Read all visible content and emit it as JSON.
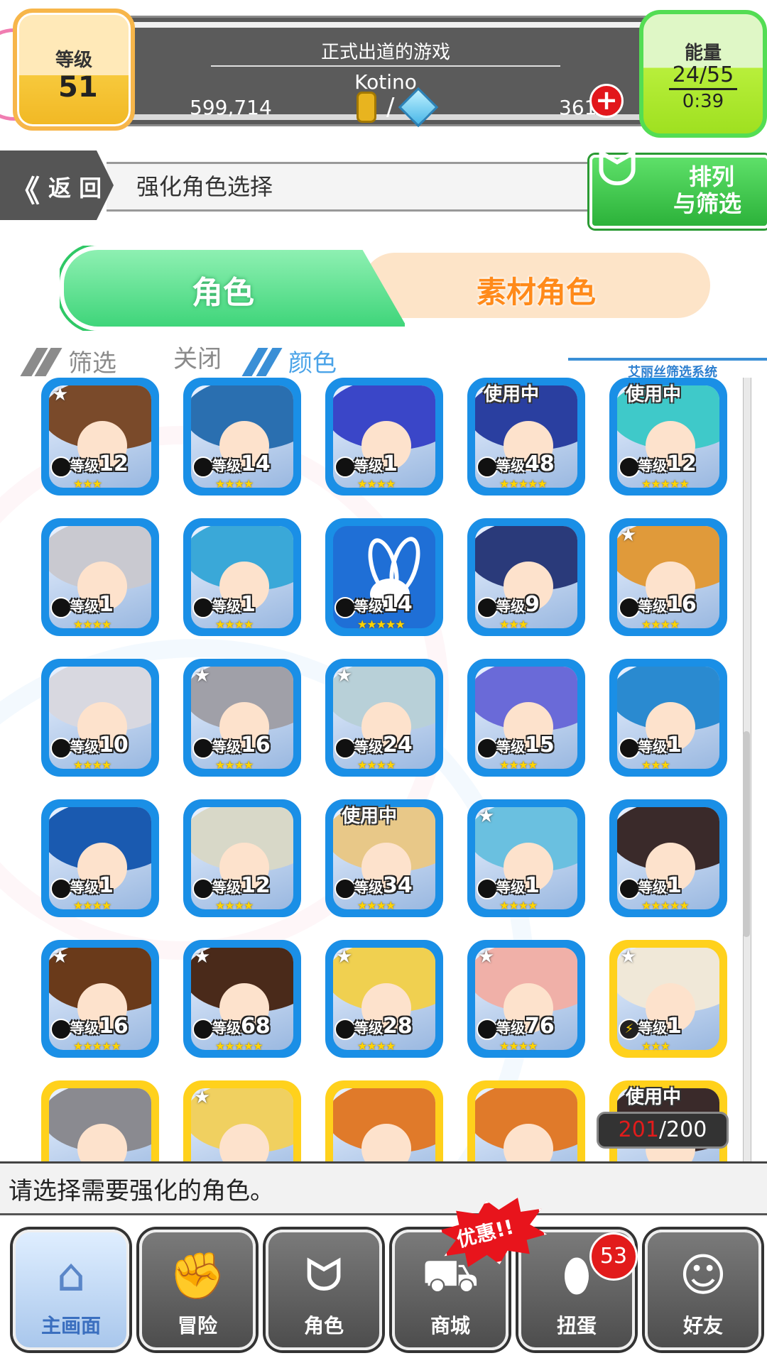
{
  "header": {
    "level_label": "等级",
    "level_value": "51",
    "game_subtitle": "正式出道的游戏",
    "player_name": "Kotino",
    "coins": "599,714",
    "currency_separator": "/",
    "gems": "361",
    "add_gem_symbol": "+",
    "energy_label": "能量",
    "energy_value": "24/55",
    "energy_timer": "0:39"
  },
  "nav_bar": {
    "back_chevrons": "《",
    "back_label": "返 回",
    "title": "强化角色选择",
    "sort_filter_label_1": "排列",
    "sort_filter_label_2": "与筛选"
  },
  "tabs": {
    "character": "角色",
    "material": "素材角色"
  },
  "filter": {
    "filter_label": "筛选",
    "close_label": "关闭",
    "color_label": "颜色",
    "system_label": "艾丽丝筛选系统"
  },
  "units": [
    {
      "level_prefix": "等级",
      "level": "12",
      "stars": "★★★",
      "top_star": "★",
      "frame": "blue",
      "element": "water-icon",
      "hair": "#7a4a2a",
      "in_use": ""
    },
    {
      "level_prefix": "等级",
      "level": "14",
      "stars": "★★★★",
      "top_star": "",
      "frame": "blue",
      "element": "water-icon",
      "hair": "#2a6fb0",
      "in_use": ""
    },
    {
      "level_prefix": "等级",
      "level": "1",
      "stars": "★★★★",
      "top_star": "",
      "frame": "blue",
      "element": "water-icon",
      "hair": "#3a46c8",
      "in_use": ""
    },
    {
      "level_prefix": "等级",
      "level": "48",
      "stars": "★★★★★",
      "top_star": "",
      "frame": "blue",
      "element": "water-icon",
      "hair": "#2a3fa0",
      "in_use": "使用中"
    },
    {
      "level_prefix": "等级",
      "level": "12",
      "stars": "★★★★★",
      "top_star": "",
      "frame": "blue",
      "element": "water-icon",
      "hair": "#3fc9c9",
      "in_use": "使用中"
    },
    {
      "level_prefix": "等级",
      "level": "1",
      "stars": "★★★★",
      "top_star": "",
      "frame": "blue",
      "element": "water-icon",
      "hair": "#c9c9d0",
      "in_use": ""
    },
    {
      "level_prefix": "等级",
      "level": "1",
      "stars": "★★★★",
      "top_star": "",
      "frame": "blue",
      "element": "water-icon",
      "hair": "#3aa8d8",
      "in_use": ""
    },
    {
      "level_prefix": "等级",
      "level": "14",
      "stars": "★★★★★",
      "top_star": "",
      "frame": "blue",
      "element": "water-icon",
      "hair": "bunny",
      "in_use": ""
    },
    {
      "level_prefix": "等级",
      "level": "9",
      "stars": "★★★",
      "top_star": "",
      "frame": "blue",
      "element": "water-icon",
      "hair": "#2a3a7a",
      "in_use": ""
    },
    {
      "level_prefix": "等级",
      "level": "16",
      "stars": "★★★★",
      "top_star": "★",
      "frame": "blue",
      "element": "water-icon",
      "hair": "#e09a3a",
      "in_use": ""
    },
    {
      "level_prefix": "等级",
      "level": "10",
      "stars": "★★★★",
      "top_star": "",
      "frame": "blue",
      "element": "water-icon",
      "hair": "#d8d8e0",
      "in_use": ""
    },
    {
      "level_prefix": "等级",
      "level": "16",
      "stars": "★★★★",
      "top_star": "★",
      "frame": "blue",
      "element": "water-icon",
      "hair": "#a0a0a8",
      "in_use": ""
    },
    {
      "level_prefix": "等级",
      "level": "24",
      "stars": "★★★★",
      "top_star": "★",
      "frame": "blue",
      "element": "water-icon",
      "hair": "#b8d0d8",
      "in_use": ""
    },
    {
      "level_prefix": "等级",
      "level": "15",
      "stars": "★★★★",
      "top_star": "",
      "frame": "blue",
      "element": "water-icon",
      "hair": "#6a6ad8",
      "in_use": ""
    },
    {
      "level_prefix": "等级",
      "level": "1",
      "stars": "★★★",
      "top_star": "",
      "frame": "blue",
      "element": "water-icon",
      "hair": "#2a8ad0",
      "in_use": ""
    },
    {
      "level_prefix": "等级",
      "level": "1",
      "stars": "★★★★",
      "top_star": "",
      "frame": "blue",
      "element": "water-icon",
      "hair": "#1a5ab0",
      "in_use": ""
    },
    {
      "level_prefix": "等级",
      "level": "12",
      "stars": "★★★★",
      "top_star": "",
      "frame": "blue",
      "element": "water-icon",
      "hair": "#d8d8c8",
      "in_use": ""
    },
    {
      "level_prefix": "等级",
      "level": "34",
      "stars": "★★★★",
      "top_star": "",
      "frame": "blue",
      "element": "water-icon",
      "hair": "#e8c888",
      "in_use": "使用中"
    },
    {
      "level_prefix": "等级",
      "level": "1",
      "stars": "★★★★",
      "top_star": "★",
      "frame": "blue",
      "element": "water-icon",
      "hair": "#6ac0e0",
      "in_use": ""
    },
    {
      "level_prefix": "等级",
      "level": "1",
      "stars": "★★★★★",
      "top_star": "",
      "frame": "blue",
      "element": "water-icon",
      "hair": "#3a2a2a",
      "in_use": ""
    },
    {
      "level_prefix": "等级",
      "level": "16",
      "stars": "★★★★★",
      "top_star": "★",
      "frame": "blue",
      "element": "water-icon",
      "hair": "#6a3a1a",
      "in_use": ""
    },
    {
      "level_prefix": "等级",
      "level": "68",
      "stars": "★★★★★",
      "top_star": "★",
      "frame": "blue",
      "element": "water-icon",
      "hair": "#4a2a1a",
      "in_use": ""
    },
    {
      "level_prefix": "等级",
      "level": "28",
      "stars": "★★★★",
      "top_star": "★",
      "frame": "blue",
      "element": "water-icon",
      "hair": "#f0d050",
      "in_use": ""
    },
    {
      "level_prefix": "等级",
      "level": "76",
      "stars": "★★★★",
      "top_star": "★",
      "frame": "blue",
      "element": "water-icon",
      "hair": "#f0b0a8",
      "in_use": ""
    },
    {
      "level_prefix": "等级",
      "level": "1",
      "stars": "★★★",
      "top_star": "★",
      "frame": "yellow",
      "element": "thunder-icon",
      "hair": "#f0e8d8",
      "in_use": ""
    },
    {
      "level_prefix": "",
      "level": "",
      "stars": "",
      "top_star": "",
      "frame": "yellow",
      "element": "",
      "hair": "#8a8a90",
      "in_use": ""
    },
    {
      "level_prefix": "",
      "level": "",
      "stars": "",
      "top_star": "★",
      "frame": "yellow",
      "element": "",
      "hair": "#f0d060",
      "in_use": ""
    },
    {
      "level_prefix": "",
      "level": "",
      "stars": "",
      "top_star": "",
      "frame": "yellow",
      "element": "",
      "hair": "#e07a2a",
      "in_use": ""
    },
    {
      "level_prefix": "",
      "level": "",
      "stars": "",
      "top_star": "",
      "frame": "yellow",
      "element": "",
      "hair": "#e07a2a",
      "in_use": ""
    },
    {
      "level_prefix": "",
      "level": "",
      "stars": "",
      "top_star": "",
      "frame": "yellow",
      "element": "",
      "hair": "#3a2a2a",
      "in_use": "使用中"
    }
  ],
  "box_count": {
    "current": "201",
    "separator": "/",
    "total": "200"
  },
  "hint": "请选择需要强化的角色。",
  "bottom_nav": [
    {
      "label": "主画面",
      "icon": "home-icon",
      "glyph": "⌂",
      "active": true
    },
    {
      "label": "冒险",
      "icon": "fist-icon",
      "glyph": "✊",
      "active": false
    },
    {
      "label": "角色",
      "icon": "bunny-icon",
      "glyph": "ᗢ",
      "active": false
    },
    {
      "label": "商城",
      "icon": "cart-icon",
      "glyph": "⛟",
      "active": false
    },
    {
      "label": "扭蛋",
      "icon": "egg-icon",
      "glyph": "⬮",
      "active": false
    },
    {
      "label": "好友",
      "icon": "friends-icon",
      "glyph": "☺",
      "active": false
    }
  ],
  "sale_badge": "优惠!!",
  "gacha_badge": "53",
  "colors": {
    "water_frame": "#1a8fe6",
    "thunder_frame": "#ffd11c",
    "tab_active": "#3fd57a",
    "tab_inactive": "#fde4c8",
    "accent_red": "#e21b1b"
  }
}
